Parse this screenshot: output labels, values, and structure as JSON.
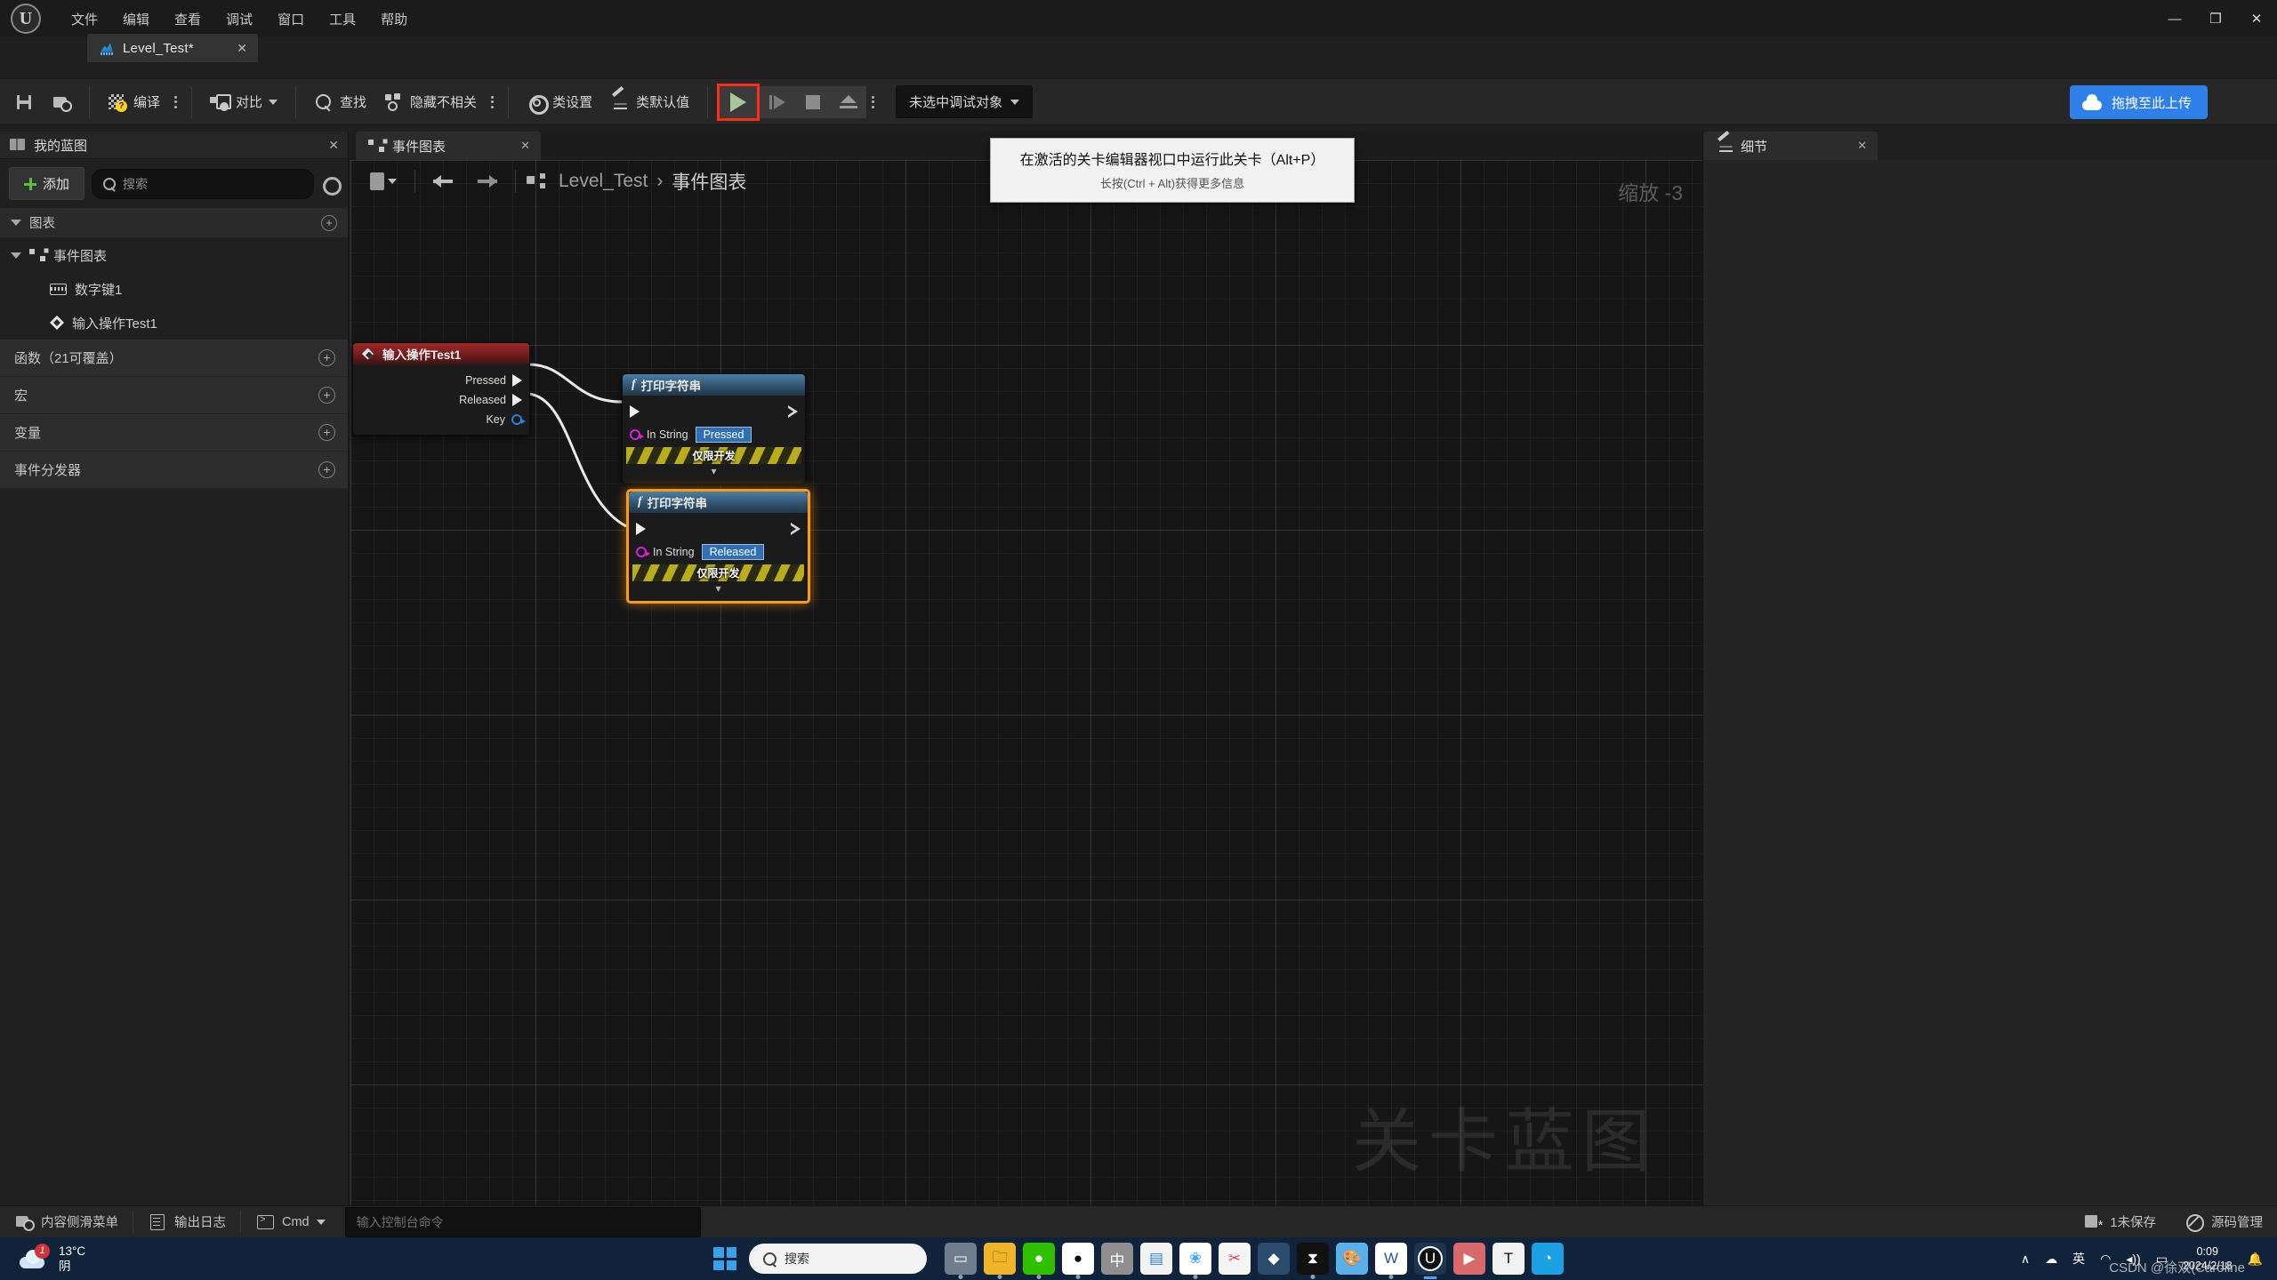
{
  "window": {
    "menu": [
      "文件",
      "编辑",
      "查看",
      "调试",
      "窗口",
      "工具",
      "帮助"
    ],
    "minimize": "—",
    "maximize": "❐",
    "close": "✕",
    "logo_letter": "U"
  },
  "doc_tab": {
    "label": "Level_Test*",
    "close": "✕"
  },
  "toolbar": {
    "save": "save-icon",
    "browse": "browse-icon",
    "compile_label": "编译",
    "diff_label": "对比",
    "find_label": "查找",
    "hide_unrelated_label": "隐藏不相关",
    "class_settings_label": "类设置",
    "class_defaults_label": "类默认值",
    "debug_target": "未选中调试对象",
    "upload_label": "拖拽至此上传"
  },
  "tooltip": {
    "title": "在激活的关卡编辑器视口中运行此关卡（Alt+P）",
    "subtitle": "长按(Ctrl + Alt)获得更多信息"
  },
  "my_blueprint": {
    "title": "我的蓝图",
    "close": "✕",
    "add_label": "添加",
    "search_placeholder": "搜索",
    "sections": [
      {
        "label": "图表",
        "type": "group"
      },
      {
        "label": "事件图表",
        "type": "graph"
      },
      {
        "label": "数字键1",
        "type": "keyboard"
      },
      {
        "label": "输入操作Test1",
        "type": "event"
      }
    ],
    "categories": [
      {
        "label": "函数（21可覆盖）"
      },
      {
        "label": "宏"
      },
      {
        "label": "变量"
      },
      {
        "label": "事件分发器"
      }
    ]
  },
  "graph": {
    "tab_label": "事件图表",
    "tab_close": "✕",
    "breadcrumb_root": "Level_Test",
    "breadcrumb_sep": "›",
    "breadcrumb_current": "事件图表",
    "zoom_label": "缩放 -3",
    "watermark": "关卡蓝图",
    "nodes": [
      {
        "id": "input-action",
        "title": "输入操作Test1",
        "kind": "event",
        "pins": [
          {
            "label": "Pressed",
            "type": "exec-out"
          },
          {
            "label": "Released",
            "type": "exec-out"
          },
          {
            "label": "Key",
            "type": "data-blue"
          }
        ]
      },
      {
        "id": "print-pressed",
        "title": "打印字符串",
        "kind": "function",
        "in_string_label": "In String",
        "in_string_value": "Pressed",
        "dev_only": "仅限开发",
        "selected": false
      },
      {
        "id": "print-released",
        "title": "打印字符串",
        "kind": "function",
        "in_string_label": "In String",
        "in_string_value": "Released",
        "dev_only": "仅限开发",
        "selected": true
      }
    ]
  },
  "details": {
    "title": "细节",
    "close": "✕"
  },
  "status_bar": {
    "content_drawer": "内容侧滑菜单",
    "output_log": "输出日志",
    "cmd_label": "Cmd",
    "cmd_placeholder": "输入控制台命令",
    "unsaved": "1未保存",
    "source_control": "源码管理"
  },
  "taskbar": {
    "weather_temp": "13°C",
    "weather_desc": "阴",
    "weather_badge": "1",
    "search_placeholder": "搜索",
    "apps": [
      {
        "name": "task-view",
        "glyph": "▭",
        "color": "#7d8b99",
        "running": true
      },
      {
        "name": "file-explorer",
        "glyph": "🗀",
        "color": "#f5c242",
        "running": true
      },
      {
        "name": "wechat",
        "glyph": "●",
        "color": "#2dc100",
        "running": true
      },
      {
        "name": "qq",
        "glyph": "●",
        "color": "#ffffff",
        "running": true
      },
      {
        "name": "input-method",
        "glyph": "中",
        "color": "#b7b7b7",
        "running": false
      },
      {
        "name": "store",
        "glyph": "▤",
        "color": "#4aa3ef",
        "running": false
      },
      {
        "name": "browser-360",
        "glyph": "❀",
        "color": "#3fa9f5",
        "running": true
      },
      {
        "name": "snipping-tool",
        "glyph": "✂",
        "color": "#e04a4a",
        "running": false
      },
      {
        "name": "firefox",
        "glyph": "◆",
        "color": "#3b6ea5",
        "running": false
      },
      {
        "name": "capcut",
        "glyph": "⧗",
        "color": "#ffffff",
        "running": true
      },
      {
        "name": "paint",
        "glyph": "🎨",
        "color": "#5ab0e8",
        "running": false
      },
      {
        "name": "word",
        "glyph": "W",
        "color": "#2b579a",
        "running": true
      },
      {
        "name": "unreal-engine",
        "glyph": "U",
        "color": "#ffffff",
        "running": true,
        "active": true
      },
      {
        "name": "media-player",
        "glyph": "▶",
        "color": "#d8696a",
        "running": false
      },
      {
        "name": "typora",
        "glyph": "T",
        "color": "#222222",
        "running": false
      },
      {
        "name": "edge",
        "glyph": "◔",
        "color": "#1ba1e2",
        "running": false
      }
    ],
    "tray": {
      "chevron": "∧",
      "cloud": "☁",
      "ime": "英",
      "wifi": "◠",
      "volume": "◂))",
      "battery": "▭",
      "time": "0:09",
      "date": "2024/2/18",
      "bell": "🔔"
    },
    "watermark": "CSDN @徐双(Caroline"
  }
}
